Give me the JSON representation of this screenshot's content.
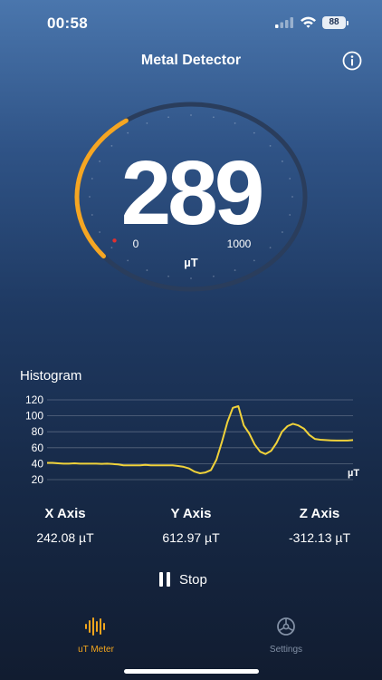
{
  "status_bar": {
    "time": "00:58",
    "battery": "88"
  },
  "header": {
    "title": "Metal Detector",
    "info_icon": "info-icon"
  },
  "gauge": {
    "reading": "289",
    "scale_min": "0",
    "scale_max": "1000",
    "unit": "µT",
    "level_fraction": 0.289,
    "colors": {
      "ring": "#2a3d5c",
      "accent": "#f5a623",
      "tick": "#cfd8e6"
    }
  },
  "histogram": {
    "title": "Histogram",
    "unit": "µT"
  },
  "chart_data": {
    "type": "line",
    "title": "Histogram",
    "xlabel": "",
    "ylabel": "µT",
    "ylim": [
      20,
      120
    ],
    "yticks": [
      "120",
      "100",
      "80",
      "60",
      "40",
      "20"
    ],
    "grid": true,
    "series": [
      {
        "color": "#f0d23a",
        "values": [
          41,
          41,
          40.5,
          40,
          40,
          40.5,
          40,
          40,
          40,
          40,
          39.8,
          40,
          39.5,
          39,
          38,
          38,
          38,
          38,
          38.5,
          38,
          38,
          38,
          38,
          37.8,
          37,
          36,
          34,
          30,
          28,
          29,
          32,
          45,
          67,
          92,
          110,
          112,
          88,
          78,
          64,
          55,
          52,
          56,
          66,
          80,
          87,
          90,
          88,
          84,
          76,
          71,
          70,
          69.5,
          69.2,
          69,
          69,
          69,
          69.5
        ]
      }
    ]
  },
  "axes": [
    {
      "name": "X Axis",
      "value": "242.08 µT"
    },
    {
      "name": "Y Axis",
      "value": "612.97 µT"
    },
    {
      "name": "Z Axis",
      "value": "-312.13 µT"
    }
  ],
  "controls": {
    "stop_label": "Stop"
  },
  "tabs": [
    {
      "label": "uT Meter",
      "icon": "waveform-icon",
      "active": true
    },
    {
      "label": "Settings",
      "icon": "settings-wheel-icon",
      "active": false
    }
  ]
}
